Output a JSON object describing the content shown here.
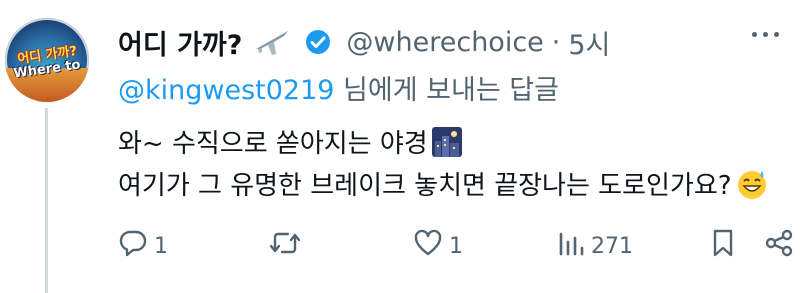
{
  "avatar": {
    "line1": "어디 가까?",
    "line2": "Where to"
  },
  "header": {
    "name": "어디 가까?",
    "handle": "@wherechoice",
    "separator": "·",
    "time": "5시"
  },
  "reply": {
    "mention": "@kingwest0219",
    "suffix": " 님에게 보내는 답글"
  },
  "body": {
    "line1": "와~ 수직으로 쏟아지는 야경",
    "line2": "여기가 그 유명한 브레이크 놓치면 끝장나는 도로인가요?"
  },
  "actions": {
    "reply_count": "1",
    "like_count": "1",
    "views_count": "271"
  },
  "colors": {
    "accent": "#1d9bf0",
    "muted": "#536471",
    "text": "#0f1419"
  }
}
